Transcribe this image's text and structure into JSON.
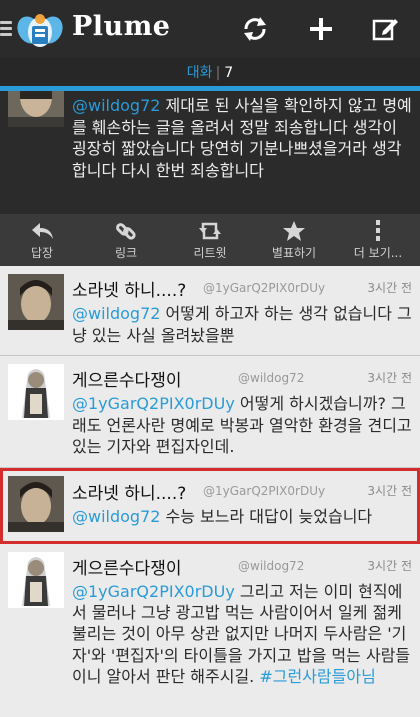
{
  "app": {
    "title": "Plume"
  },
  "toolbar": {
    "refresh_icon": "refresh-icon",
    "add_icon": "plus-icon",
    "compose_icon": "compose-icon"
  },
  "conversation": {
    "label": "대화",
    "count": "7"
  },
  "selected_tweet": {
    "mention": "@wildog72",
    "text": " 제대로 된 사실을 확인하지 않고 명예를 훼손하는 글을 올려서 정말 죄송합니다 생각이 굉장히 짧았습니다 당연히 기분나쁘셨을거라 생각합니다 다시 한번 죄송합니다"
  },
  "actions": [
    {
      "icon": "reply-icon",
      "label": "답장"
    },
    {
      "icon": "link-icon",
      "label": "링크"
    },
    {
      "icon": "retweet-icon",
      "label": "리트윗"
    },
    {
      "icon": "star-icon",
      "label": "별표하기"
    },
    {
      "icon": "more-icon",
      "label": "더 보기..."
    }
  ],
  "tweets": [
    {
      "name": "소라넷 하니....?",
      "handle": "@1yGarQ2PIX0rDUy",
      "time": "3시간 전",
      "mention": "@wildog72",
      "text": " 어떻게 하고자 하는 생각 없습니다 그냥 있는 사실 올려놨을뿐",
      "hashtag": ""
    },
    {
      "name": "게으른수다쟁이",
      "handle": "@wildog72",
      "time": "3시간 전",
      "mention": "@1yGarQ2PIX0rDUy",
      "text": " 어떻게 하시겠습니까? 그래도 언론사란 명예로 박봉과 열악한 환경을 견디고 있는 기자와 편집자인데.",
      "hashtag": ""
    },
    {
      "name": "소라넷 하니....?",
      "handle": "@1yGarQ2PIX0rDUy",
      "time": "3시간 전",
      "mention": "@wildog72",
      "text": " 수능 보느라 대답이 늦었습니다",
      "hashtag": ""
    },
    {
      "name": "게으른수다쟁이",
      "handle": "@wildog72",
      "time": "3시간 전",
      "mention": "@1yGarQ2PIX0rDUy",
      "text": " 그리고 저는 이미 현직에서 물러나 그냥 광고밥 먹는 사람이어서 일케 젊케 불리는 것이 아무 상관 없지만 나머지 두사람은 '기자'와 '편집자'의 타이틀을 가지고 밥을 먹는 사람들이니 알아서 판단 해주시길. ",
      "hashtag": "#그런사람들아님"
    }
  ],
  "colors": {
    "accent": "#2a9bd8",
    "highlight": "#d32d2d",
    "dark_bg": "#2b2b2b",
    "list_bg": "#ebebeb"
  }
}
